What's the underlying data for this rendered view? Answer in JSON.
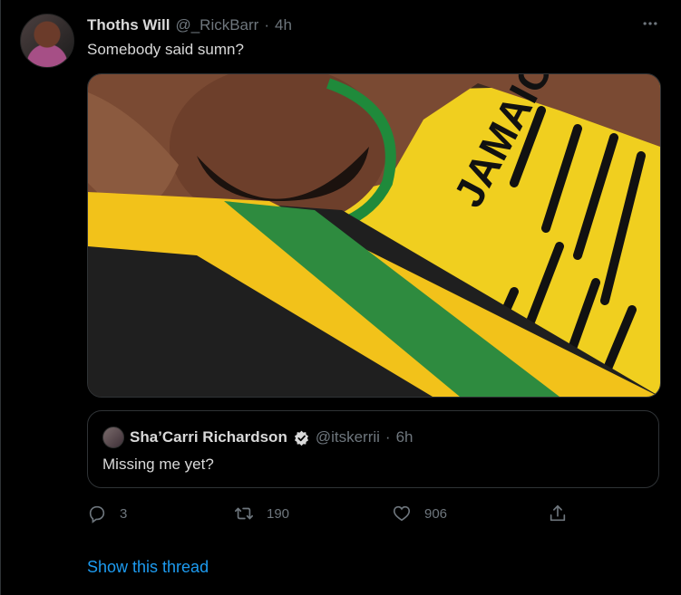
{
  "tweet": {
    "author_name": "Thoths Will",
    "author_handle": "@_RickBarr",
    "separator": "·",
    "time": "4h",
    "text": "Somebody said sumn?",
    "more_icon": "more-horizontal-icon",
    "media_alt": "photo"
  },
  "quoted_tweet": {
    "author_name": "Sha’Carri Richardson",
    "verified_icon": "verified-badge-icon",
    "author_handle": "@itskerrii",
    "separator": "·",
    "time": "6h",
    "text": "Missing me yet?"
  },
  "actions": {
    "reply": {
      "icon": "reply-icon",
      "count": "3"
    },
    "retweet": {
      "icon": "retweet-icon",
      "count": "190"
    },
    "like": {
      "icon": "heart-icon",
      "count": "906"
    },
    "share": {
      "icon": "share-icon"
    }
  },
  "show_thread_label": "Show this thread",
  "colors": {
    "background": "#000000",
    "text_primary": "#d9d9d9",
    "text_secondary": "#6e767d",
    "link": "#1d9bf0",
    "border": "#2f3336",
    "verified": "#d9d9d9"
  }
}
